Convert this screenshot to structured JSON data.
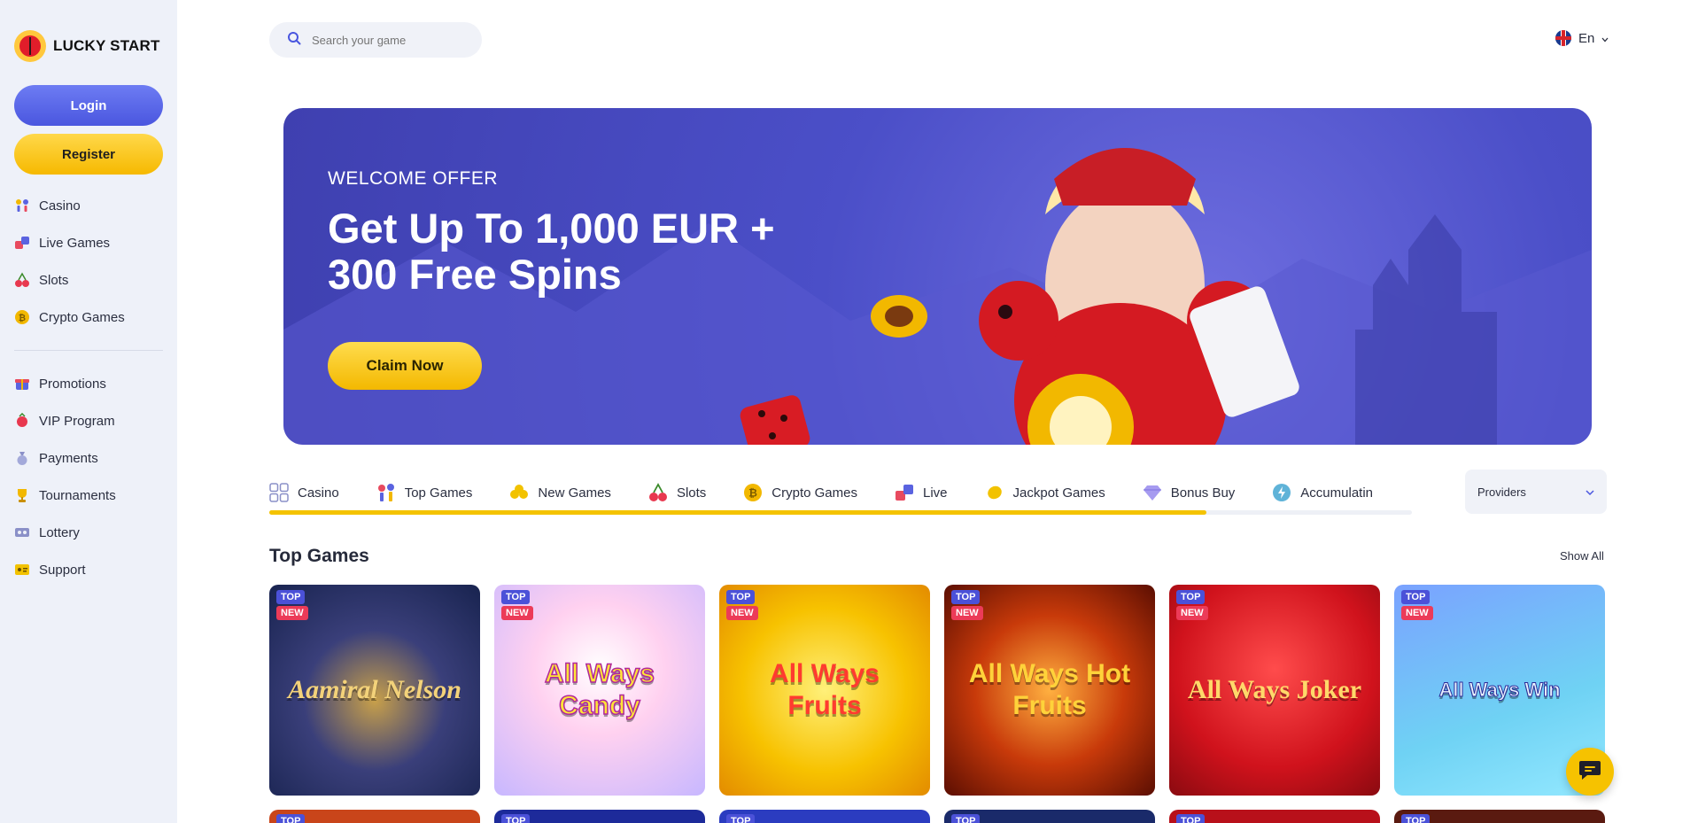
{
  "brand": {
    "name": "LUCKY START"
  },
  "sidebar": {
    "login_label": "Login",
    "register_label": "Register",
    "items_main": [
      {
        "label": "Casino",
        "icon": "casino-icon"
      },
      {
        "label": "Live Games",
        "icon": "live-games-icon"
      },
      {
        "label": "Slots",
        "icon": "cherries-icon"
      },
      {
        "label": "Crypto Games",
        "icon": "bitcoin-icon"
      }
    ],
    "items_secondary": [
      {
        "label": "Promotions",
        "icon": "gift-icon"
      },
      {
        "label": "VIP Program",
        "icon": "vip-icon"
      },
      {
        "label": "Payments",
        "icon": "money-bag-icon"
      },
      {
        "label": "Tournaments",
        "icon": "trophy-icon"
      },
      {
        "label": "Lottery",
        "icon": "ticket-icon"
      },
      {
        "label": "Support",
        "icon": "support-icon"
      }
    ]
  },
  "header": {
    "search_placeholder": "Search your game",
    "language": "En"
  },
  "banner": {
    "subtitle": "WELCOME OFFER",
    "title": "Get Up To 1,000 EUR + 300 Free Spins",
    "cta_label": "Claim Now"
  },
  "tabs": [
    {
      "label": "Casino",
      "icon": "grid-icon"
    },
    {
      "label": "Top Games",
      "icon": "top-games-icon"
    },
    {
      "label": "New Games",
      "icon": "clover-icon"
    },
    {
      "label": "Slots",
      "icon": "cherries-icon"
    },
    {
      "label": "Crypto Games",
      "icon": "bitcoin-icon"
    },
    {
      "label": "Live",
      "icon": "live-icon"
    },
    {
      "label": "Jackpot Games",
      "icon": "jackpot-icon"
    },
    {
      "label": "Bonus Buy",
      "icon": "diamond-icon"
    },
    {
      "label": "Accumulatin",
      "icon": "lightning-icon"
    }
  ],
  "tabs_scroll_progress": 0.82,
  "providers_label": "Providers",
  "section": {
    "title": "Top Games",
    "show_all_label": "Show All"
  },
  "badges": {
    "top": "TOP",
    "new": "NEW"
  },
  "games": [
    {
      "title": "Aamiral Nelson"
    },
    {
      "title": "All Ways Candy"
    },
    {
      "title": "All Ways Fruits"
    },
    {
      "title": "All Ways Hot Fruits"
    },
    {
      "title": "All Ways Joker"
    },
    {
      "title": "All Ways Win"
    }
  ],
  "colors": {
    "accent_blue": "#4a56df",
    "accent_yellow": "#f6b900",
    "badge_top": "#4b51d8",
    "badge_new": "#ec3b58",
    "sidebar_bg": "#eef1f9"
  }
}
